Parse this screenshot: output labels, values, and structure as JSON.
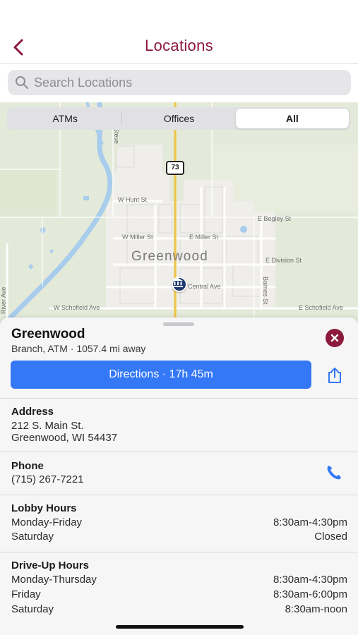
{
  "nav": {
    "title": "Locations"
  },
  "search": {
    "placeholder": "Search Locations"
  },
  "filter": {
    "options": [
      "ATMs",
      "Offices",
      "All"
    ],
    "selected": "All"
  },
  "map": {
    "town_label": "Greenwood",
    "highway_shield": "73",
    "streets": {
      "w_hunt": "W Hunt St",
      "e_begley": "E Begley St",
      "w_miller": "W Miller St",
      "e_miller": "E Miller St",
      "e_division": "E Division St",
      "central": "Central Ave",
      "barnes": "Barnes St",
      "w_schofield": "W Schofield Ave",
      "e_schofield": "E Schofield Ave",
      "river": "River Ave",
      "steve": "Steve"
    }
  },
  "location": {
    "name": "Greenwood",
    "subtitle": "Branch, ATM · 1057.4 mi away",
    "directions_label": "Directions · 17h 45m"
  },
  "address": {
    "heading": "Address",
    "line1": "212 S. Main St.",
    "line2": "Greenwood, WI 54437"
  },
  "phone": {
    "heading": "Phone",
    "number": "(715) 267-7221"
  },
  "lobby_hours": {
    "heading": "Lobby Hours",
    "rows": [
      {
        "day": "Monday-Friday",
        "hours": "8:30am-4:30pm"
      },
      {
        "day": "Saturday",
        "hours": "Closed"
      }
    ]
  },
  "driveup_hours": {
    "heading": "Drive-Up Hours",
    "rows": [
      {
        "day": "Monday-Thursday",
        "hours": "8:30am-4:30pm"
      },
      {
        "day": "Friday",
        "hours": "8:30am-6:00pm"
      },
      {
        "day": "Saturday",
        "hours": "8:30am-noon"
      }
    ]
  },
  "colors": {
    "brand": "#8b1a3d",
    "action_blue": "#3478f6",
    "map_land": "#e4ead9",
    "water": "#a8cdec"
  },
  "icons": {
    "back": "chevron-left-icon",
    "search": "search-icon",
    "close": "close-icon",
    "share": "share-icon",
    "phone": "phone-icon",
    "bank": "bank-icon"
  }
}
